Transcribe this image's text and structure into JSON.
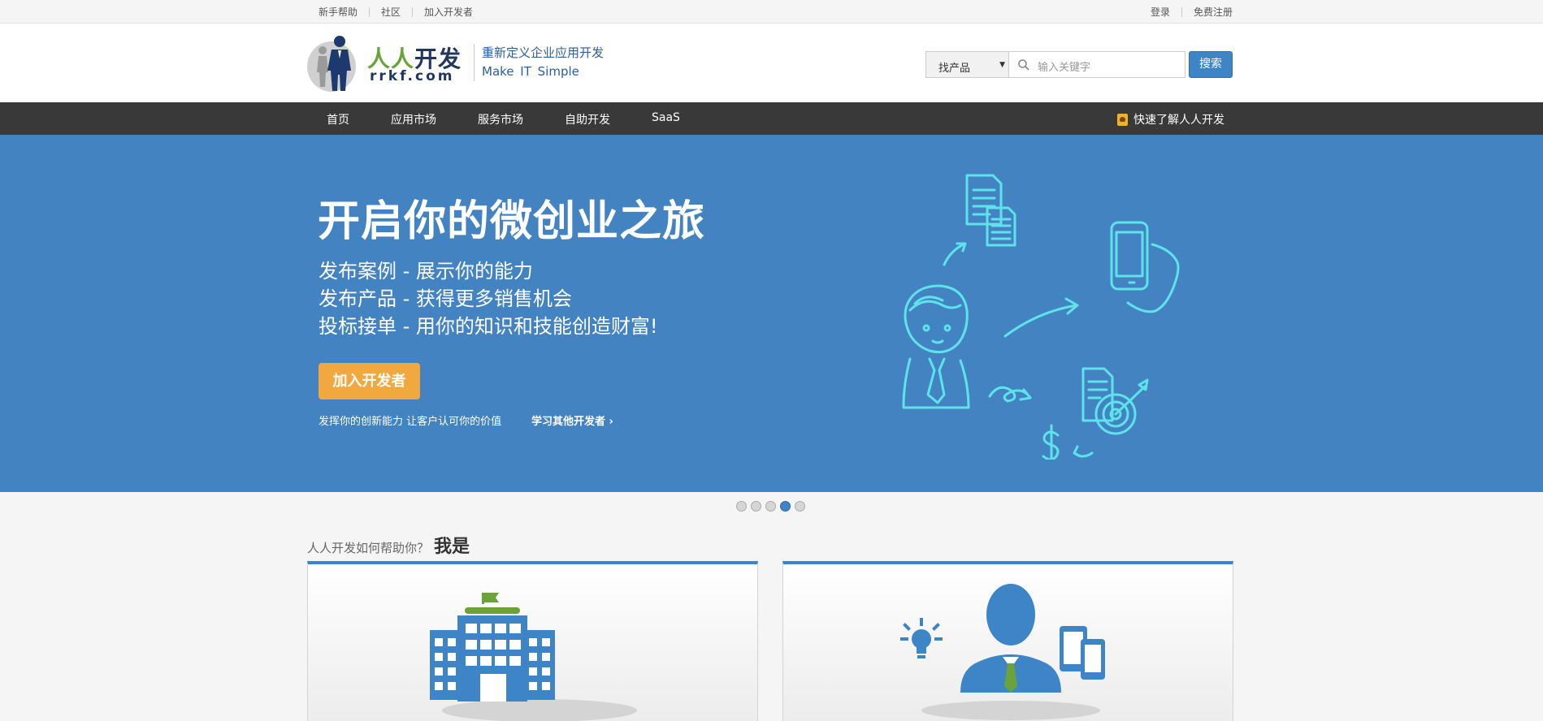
{
  "topbar": {
    "left_links": [
      "新手帮助",
      "社区",
      "加入开发者"
    ],
    "right_links": [
      "登录",
      "免费注册"
    ]
  },
  "header": {
    "brand_cn_part1": "人人",
    "brand_cn_part2": "开发",
    "brand_en": "rrkf.com",
    "slogan_line1": "重新定义企业应用开发",
    "slogan_line2": "Make IT Simple",
    "search": {
      "category": "找产品",
      "placeholder": "输入关键字",
      "button": "搜索"
    }
  },
  "nav": {
    "items": [
      "首页",
      "应用市场",
      "服务市场",
      "自助开发",
      "SaaS"
    ],
    "quick_link": "快速了解人人开发"
  },
  "banner": {
    "title": "开启你的微创业之旅",
    "lines": [
      "发布案例 - 展示你的能力",
      "发布产品 - 获得更多销售机会",
      "投标接单 - 用你的知识和技能创造财富!"
    ],
    "cta": "加入开发者",
    "tagline": "发挥你的创新能力 让客户认可你的价值",
    "learn_more": "学习其他开发者 ›"
  },
  "carousel": {
    "count": 5,
    "active_index": 3
  },
  "section": {
    "question": "人人开发如何帮助你？",
    "emphasis": "我是"
  },
  "colors": {
    "brand_blue": "#3e85c8",
    "banner_bg": "#4383c2",
    "nav_bg": "#393939",
    "cta_orange": "#f0a83f",
    "brand_green": "#6aa33a",
    "icon_cyan": "#5fe3ea"
  },
  "icons": [
    "logo-person-icon",
    "search-icon",
    "dropdown-caret-icon",
    "guide-icon",
    "building-icon",
    "developer-icon"
  ]
}
